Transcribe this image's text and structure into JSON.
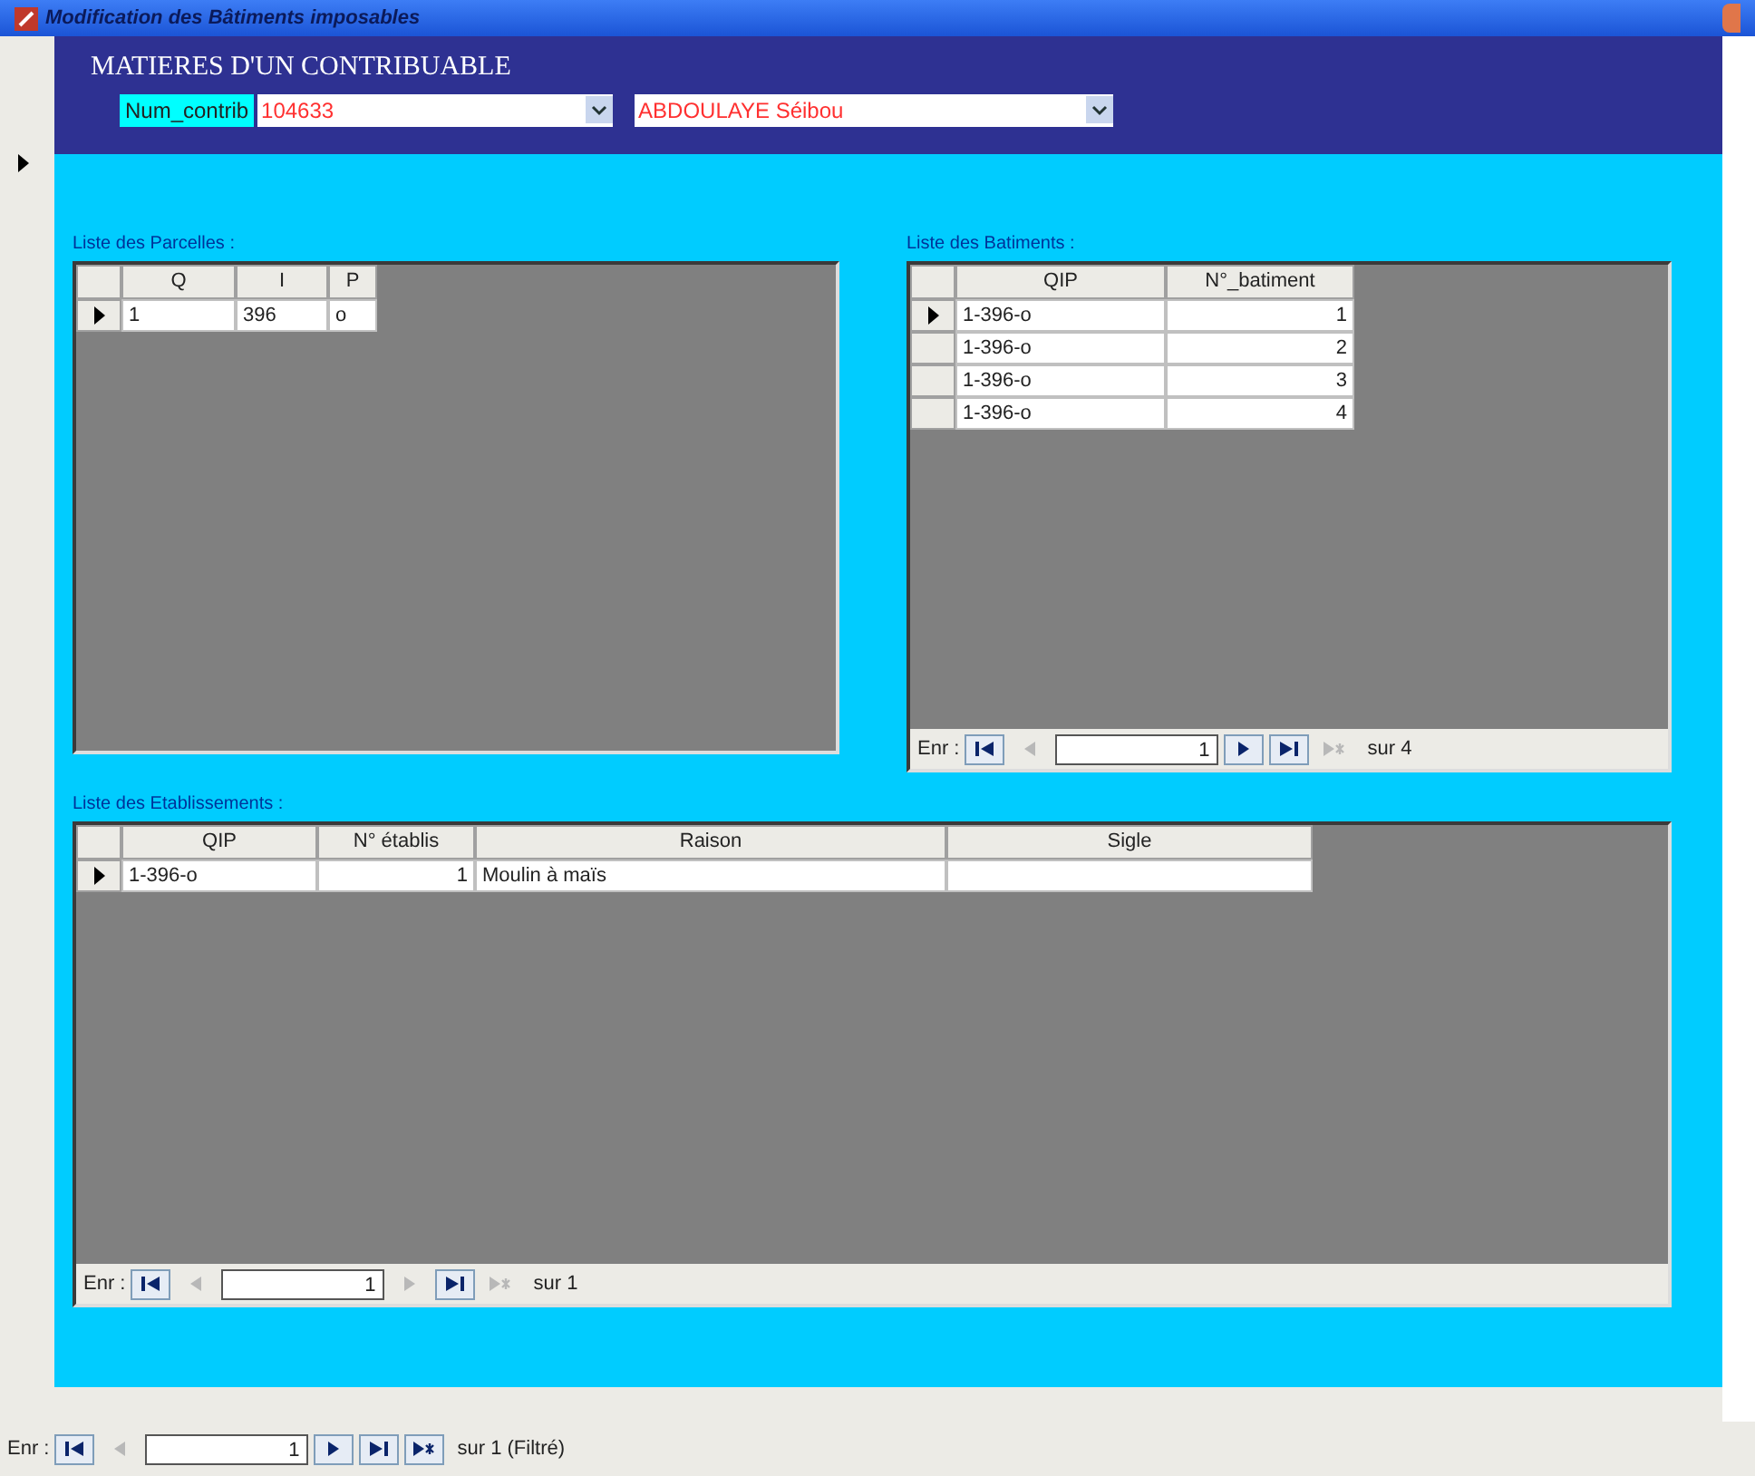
{
  "window": {
    "title": "Modification des Bâtiments imposables"
  },
  "header": {
    "title": "MATIERES D'UN CONTRIBUABLE",
    "label": "Num_contrib",
    "num_value": "104633",
    "name_value": "ABDOULAYE Séibou"
  },
  "parcelles": {
    "label": "Liste des Parcelles :",
    "columns": [
      "Q",
      "I",
      "P"
    ],
    "rows": [
      {
        "selected": true,
        "cells": [
          "1",
          "396",
          "o"
        ]
      }
    ]
  },
  "batiments": {
    "label": "Liste des Batiments :",
    "columns": [
      "QIP",
      "N°_batiment"
    ],
    "rows": [
      {
        "selected": true,
        "cells": [
          "1-396-o",
          "1"
        ]
      },
      {
        "selected": false,
        "cells": [
          "1-396-o",
          "2"
        ]
      },
      {
        "selected": false,
        "cells": [
          "1-396-o",
          "3"
        ]
      },
      {
        "selected": false,
        "cells": [
          "1-396-o",
          "4"
        ]
      }
    ],
    "nav": {
      "label": "Enr :",
      "value": "1",
      "count": "sur 4",
      "buttons": [
        {
          "kind": "first",
          "disabled": false
        },
        {
          "kind": "prev",
          "disabled": true
        },
        {
          "kind": "next",
          "disabled": false
        },
        {
          "kind": "last",
          "disabled": false
        },
        {
          "kind": "new",
          "disabled": true
        }
      ]
    }
  },
  "etablissements": {
    "label": "Liste des Etablissements :",
    "columns": [
      "QIP",
      "N° établis",
      "Raison",
      "Sigle"
    ],
    "rows": [
      {
        "selected": true,
        "cells": [
          "1-396-o",
          "1",
          "Moulin à maïs",
          ""
        ]
      }
    ],
    "nav": {
      "label": "Enr :",
      "value": "1",
      "count": "sur 1",
      "buttons": [
        {
          "kind": "first",
          "disabled": false
        },
        {
          "kind": "prev",
          "disabled": true
        },
        {
          "kind": "next",
          "disabled": true
        },
        {
          "kind": "last",
          "disabled": false
        },
        {
          "kind": "new",
          "disabled": true
        }
      ]
    }
  },
  "main_nav": {
    "label": "Enr :",
    "value": "1",
    "count": "sur 1 (Filtré)",
    "buttons": [
      {
        "kind": "first",
        "disabled": false
      },
      {
        "kind": "prev",
        "disabled": true
      },
      {
        "kind": "next",
        "disabled": false
      },
      {
        "kind": "last",
        "disabled": false
      },
      {
        "kind": "new",
        "disabled": false
      }
    ]
  }
}
